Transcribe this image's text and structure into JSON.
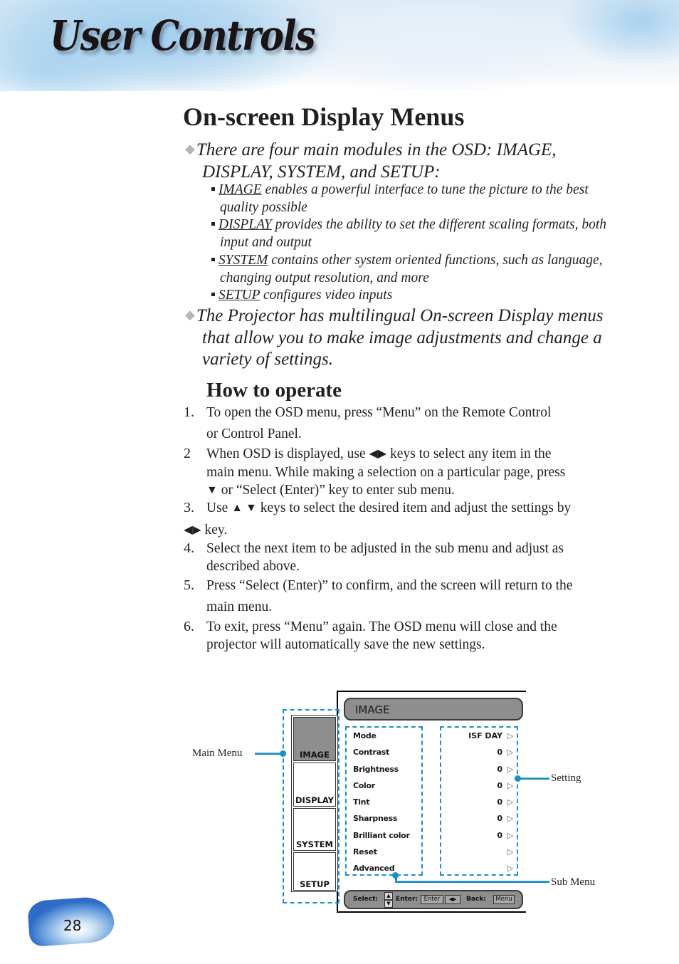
{
  "header": {
    "title": "User Controls"
  },
  "section": {
    "title": "On-screen Display Menus",
    "bullets": [
      {
        "line1": "There are four main modules in the OSD: IMAGE,",
        "line2": "DISPLAY, SYSTEM, and SETUP:"
      },
      {
        "line1": "The Projector has multilingual On-screen Display menus",
        "line2": "that allow you to make image adjustments and change a",
        "line3": "variety of settings."
      }
    ],
    "modules": [
      {
        "keyword": "IMAGE",
        "line1": " enables a powerful interface to tune the picture to the best",
        "line2": "quality possible"
      },
      {
        "keyword": "DISPLAY",
        "line1": " provides the ability to set the different scaling formats, both",
        "line2": "input and output"
      },
      {
        "keyword": "SYSTEM",
        "line1": " contains other system oriented functions, such as language,",
        "line2": "changing output resolution, and more"
      },
      {
        "keyword": "SETUP",
        "line1": " configures video inputs",
        "line2": ""
      }
    ]
  },
  "how_to": {
    "title": "How to operate",
    "steps": [
      {
        "num": "1.",
        "a": "To open the OSD menu, press “Menu” on the Remote Control",
        "b": "or Control Panel."
      },
      {
        "num": "2",
        "a1": "When OSD is displayed, use ",
        "a2": " keys to select any item in the",
        "b": "main menu. While making a selection on a particular page, press",
        "c": " or “Select (Enter)” key to enter sub menu."
      },
      {
        "num": "3.",
        "a1": "Use ",
        "a2": " keys to select the desired item and adjust the settings by",
        "b": " key."
      },
      {
        "num": "4.",
        "a": "Select the next item to be adjusted in the sub menu and adjust as",
        "b": "described above."
      },
      {
        "num": "5.",
        "a": "Press “Select (Enter)” to confirm, and the screen will return to the",
        "b": "main menu."
      },
      {
        "num": "6.",
        "a": "To exit, press “Menu” again. The OSD menu will close and the",
        "b": "projector will automatically save the new settings."
      }
    ],
    "glyphs": {
      "left_right": "◀▶",
      "down": "▼",
      "up_down": "▲ ▼"
    }
  },
  "osd": {
    "title": "IMAGE",
    "main_menu": [
      "IMAGE",
      "DISPLAY",
      "SYSTEM",
      "SETUP"
    ],
    "active_main": "IMAGE",
    "sub_menu": [
      {
        "label": "Mode",
        "value": "ISF DAY"
      },
      {
        "label": "Contrast",
        "value": "0"
      },
      {
        "label": "Brightness",
        "value": "0"
      },
      {
        "label": "Color",
        "value": "0"
      },
      {
        "label": "Tint",
        "value": "0"
      },
      {
        "label": "Sharpness",
        "value": "0"
      },
      {
        "label": "Brilliant color",
        "value": "0"
      },
      {
        "label": "Reset",
        "value": ""
      },
      {
        "label": "Advanced",
        "value": ""
      }
    ],
    "arrow_glyph": "▷",
    "footer": {
      "select_label": "Select:",
      "enter_label": "Enter:",
      "enter_key": "Enter",
      "lr_keys": "◀▶",
      "back_label": "Back:",
      "menu_key": "Menu",
      "up": "▲",
      "down": "▼"
    },
    "callouts": {
      "main_menu": "Main Menu",
      "setting": "Setting",
      "sub_menu": "Sub Menu"
    },
    "accent_color": "#1a8fc7"
  },
  "page_number": "28"
}
